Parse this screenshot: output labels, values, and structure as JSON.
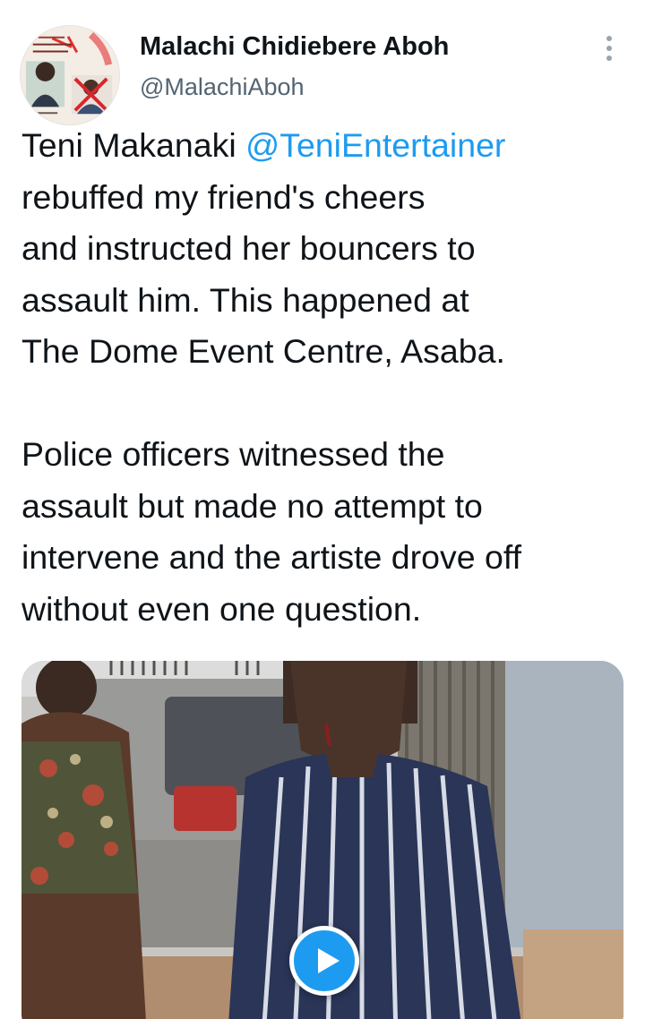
{
  "author": {
    "display_name": "Malachi Chidiebere Aboh",
    "handle": "@MalachiAboh",
    "avatar_icon": "profile-collage-avatar"
  },
  "tweet": {
    "lines_paragraph_1": [
      {
        "pre": "Teni Makanaki ",
        "mention": "@TeniEntertainer"
      },
      {
        "text": "rebuffed my friend's cheers"
      },
      {
        "text": "and instructed her bouncers to"
      },
      {
        "text": "assault him. This happened at"
      },
      {
        "text": "The Dome Event Centre, Asaba."
      }
    ],
    "lines_paragraph_2": [
      "Police officers witnessed the",
      "assault but made no attempt to",
      "intervene and the artiste drove off",
      "without even one question."
    ]
  },
  "media": {
    "type": "video",
    "play_icon": "play-icon"
  },
  "colors": {
    "accent": "#1d9bf0",
    "text": "#0f1419",
    "muted": "#536471"
  }
}
